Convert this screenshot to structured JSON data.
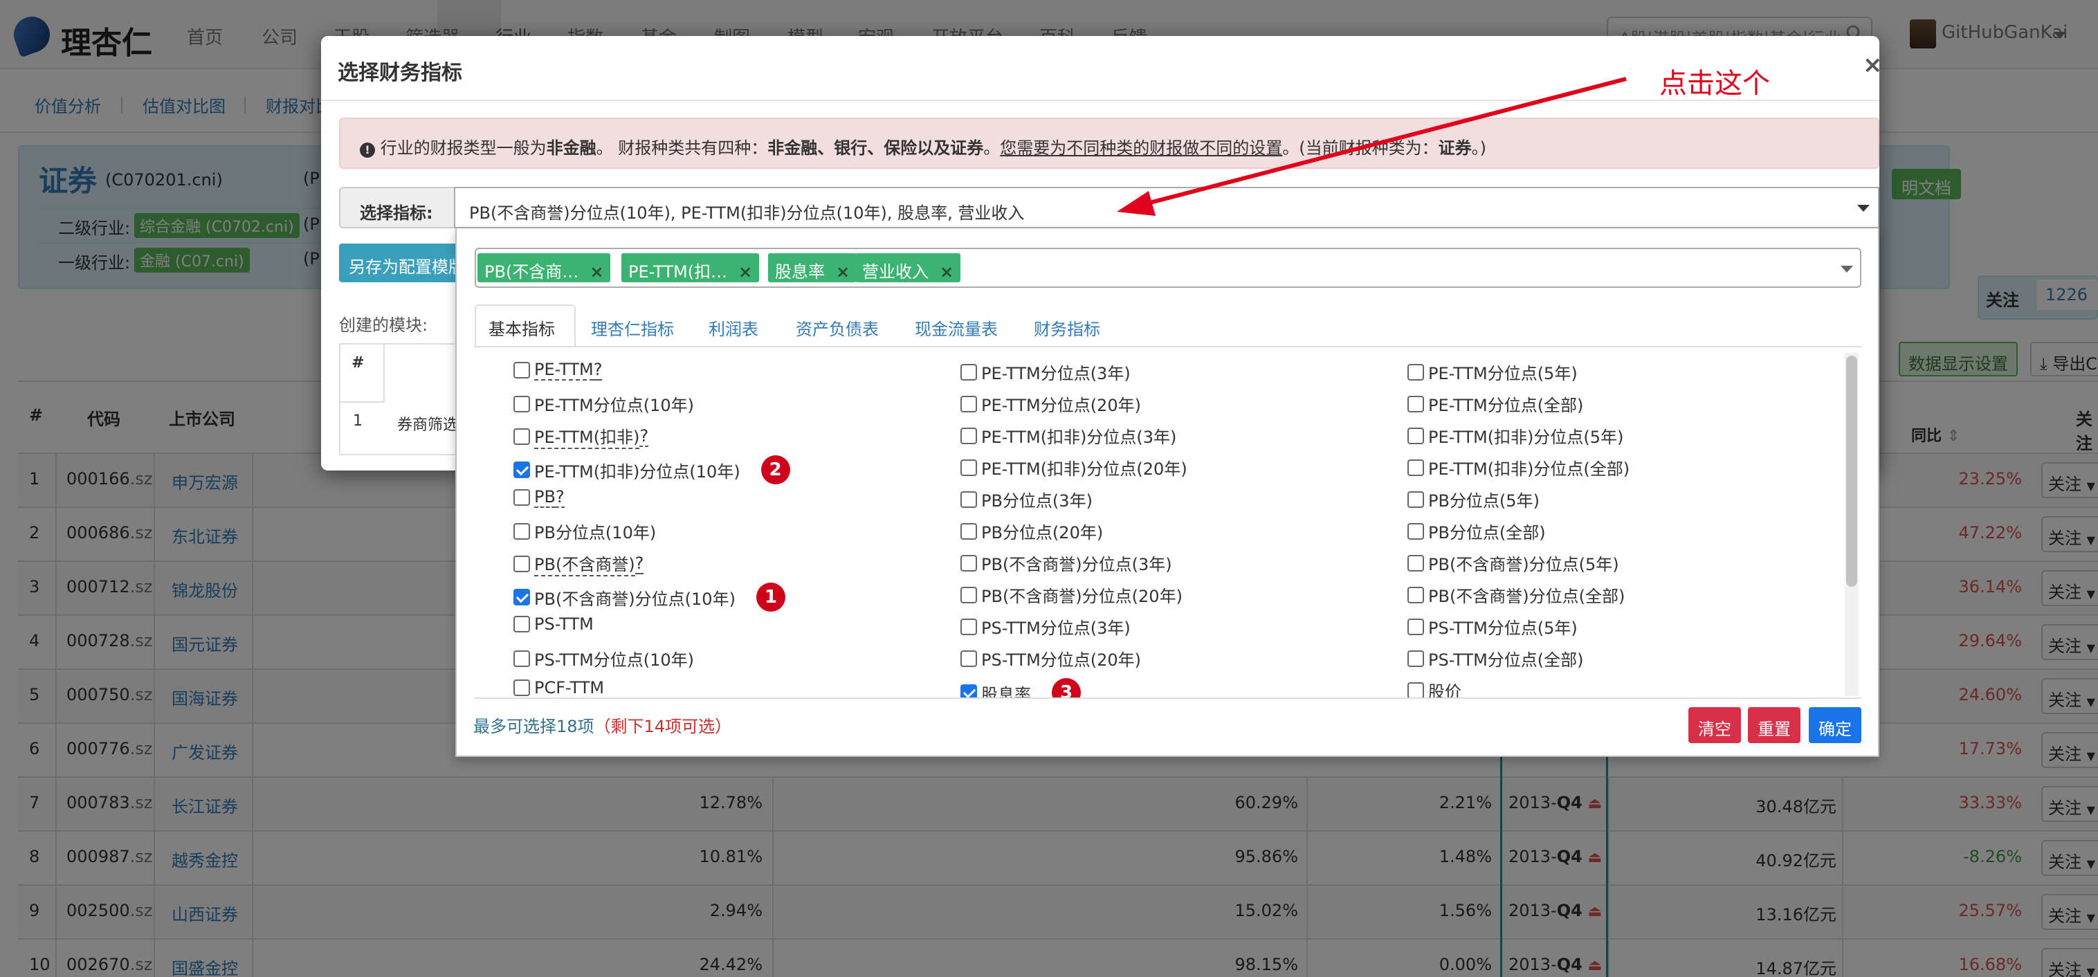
{
  "brand": {
    "name": "理杏仁"
  },
  "topnav": {
    "items": [
      "首页",
      "公司",
      "干股",
      "筛选器",
      "行业",
      "指数",
      "基金",
      "制图",
      "模型",
      "宏观",
      "开放平台",
      "百科",
      "反馈"
    ],
    "search_placeholder": "A股|港股|美股|指数|基金|行业",
    "user": "GitHubGanKai"
  },
  "subnav": {
    "items": [
      "价值分析",
      "估值对比图",
      "财报对比"
    ]
  },
  "industry": {
    "title": "证券",
    "code": "(C070201.cni)",
    "level2_label": "二级行业:",
    "level2_value": "综合金融 (C0702.cni)",
    "level1_label": "一级行业:",
    "level1_value": "金融 (C07.cni)",
    "pe_prefix": "(P",
    "doc_btn": "明文档"
  },
  "follow": {
    "label": "关注",
    "count": "1226"
  },
  "toolbar": {
    "display_setting": "数据显示设置",
    "export": "导出C"
  },
  "table": {
    "headers": {
      "idx": "#",
      "code": "代码",
      "company": "上市公司",
      "yoy": "同比",
      "follow": "关注"
    },
    "rows": [
      {
        "idx": "1",
        "code": "000166",
        "suffix": ".sz",
        "name": "申万宏源",
        "yoy": "23.25%",
        "yoy_color": "red"
      },
      {
        "idx": "2",
        "code": "000686",
        "suffix": ".sz",
        "name": "东北证券",
        "yoy": "47.22%",
        "yoy_color": "red"
      },
      {
        "idx": "3",
        "code": "000712",
        "suffix": ".sz",
        "name": "锦龙股份",
        "yoy": "36.14%",
        "yoy_color": "red"
      },
      {
        "idx": "4",
        "code": "000728",
        "suffix": ".sz",
        "name": "国元证券",
        "yoy": "29.64%",
        "yoy_color": "red"
      },
      {
        "idx": "5",
        "code": "000750",
        "suffix": ".sz",
        "name": "国海证券",
        "yoy": "24.60%",
        "yoy_color": "red"
      },
      {
        "idx": "6",
        "code": "000776",
        "suffix": ".sz",
        "name": "广发证券",
        "yoy": "17.73%",
        "yoy_color": "red"
      },
      {
        "idx": "7",
        "code": "000783",
        "suffix": ".sz",
        "name": "长江证券",
        "c1": "12.78%",
        "c2": "60.29%",
        "c3": "2.21%",
        "period": "2013-",
        "q": "Q4",
        "rev": "30.48亿元",
        "yoy": "33.33%",
        "yoy_color": "red"
      },
      {
        "idx": "8",
        "code": "000987",
        "suffix": ".sz",
        "name": "越秀金控",
        "c1": "10.81%",
        "c2": "95.86%",
        "c3": "1.48%",
        "period": "2013-",
        "q": "Q4",
        "rev": "40.92亿元",
        "yoy": "-8.26%",
        "yoy_color": "green"
      },
      {
        "idx": "9",
        "code": "002500",
        "suffix": ".sz",
        "name": "山西证券",
        "c1": "2.94%",
        "c2": "15.02%",
        "c3": "1.56%",
        "period": "2013-",
        "q": "Q4",
        "rev": "13.16亿元",
        "yoy": "25.57%",
        "yoy_color": "red"
      },
      {
        "idx": "10",
        "code": "002670",
        "suffix": ".sz",
        "name": "国盛金控",
        "c1": "24.42%",
        "c2": "98.15%",
        "c3": "0.00%",
        "period": "2013-",
        "q": "Q4",
        "rev": "14.87亿元",
        "yoy": "16.68%",
        "yoy_color": "red"
      }
    ],
    "follow_btn": "关注"
  },
  "modal": {
    "title": "选择财务指标",
    "close": "×",
    "alert": {
      "p1": "行业的财报类型一般为",
      "b1": "非金融",
      "p2": "。 财报种类共有四种：",
      "b2": "非金融、银行、保险以及证券",
      "p3": "。",
      "link": "您需要为不同种类的财报做不同的设置",
      "p4": "。(当前财报种类为：",
      "b3": "证券",
      "p5": "。)"
    },
    "select_label": "选择指标:",
    "select_value": "PB(不含商誉)分位点(10年), PE-TTM(扣非)分位点(10年), 股息率, 营业收入",
    "save_config": "另存为配置模版",
    "created_label": "创建的模块:",
    "module_hash": "#",
    "module_row_idx": "1",
    "module_row_name": "券商筛选"
  },
  "dropdown": {
    "tags": [
      "PB(不含商…",
      "PE-TTM(扣…",
      "股息率",
      "营业收入"
    ],
    "tabs": [
      "基本指标",
      "理杏仁指标",
      "利润表",
      "资产负债表",
      "现金流量表",
      "财务指标"
    ],
    "options": [
      [
        {
          "label": "PE-TTM",
          "q": true,
          "checked": false
        },
        {
          "label": "PE-TTM分位点(3年)",
          "checked": false
        },
        {
          "label": "PE-TTM分位点(5年)",
          "checked": false
        }
      ],
      [
        {
          "label": "PE-TTM分位点(10年)",
          "checked": false
        },
        {
          "label": "PE-TTM分位点(20年)",
          "checked": false
        },
        {
          "label": "PE-TTM分位点(全部)",
          "checked": false
        }
      ],
      [
        {
          "label": "PE-TTM(扣非)",
          "q": true,
          "checked": false
        },
        {
          "label": "PE-TTM(扣非)分位点(3年)",
          "checked": false
        },
        {
          "label": "PE-TTM(扣非)分位点(5年)",
          "checked": false
        }
      ],
      [
        {
          "label": "PE-TTM(扣非)分位点(10年)",
          "checked": true,
          "badge": "2"
        },
        {
          "label": "PE-TTM(扣非)分位点(20年)",
          "checked": false
        },
        {
          "label": "PE-TTM(扣非)分位点(全部)",
          "checked": false
        }
      ],
      [
        {
          "label": "PB",
          "q": true,
          "checked": false
        },
        {
          "label": "PB分位点(3年)",
          "checked": false
        },
        {
          "label": "PB分位点(5年)",
          "checked": false
        }
      ],
      [
        {
          "label": "PB分位点(10年)",
          "checked": false
        },
        {
          "label": "PB分位点(20年)",
          "checked": false
        },
        {
          "label": "PB分位点(全部)",
          "checked": false
        }
      ],
      [
        {
          "label": "PB(不含商誉)",
          "q": true,
          "checked": false
        },
        {
          "label": "PB(不含商誉)分位点(3年)",
          "checked": false
        },
        {
          "label": "PB(不含商誉)分位点(5年)",
          "checked": false
        }
      ],
      [
        {
          "label": "PB(不含商誉)分位点(10年)",
          "checked": true,
          "badge": "1"
        },
        {
          "label": "PB(不含商誉)分位点(20年)",
          "checked": false
        },
        {
          "label": "PB(不含商誉)分位点(全部)",
          "checked": false
        }
      ],
      [
        {
          "label": "PS-TTM",
          "checked": false
        },
        {
          "label": "PS-TTM分位点(3年)",
          "checked": false
        },
        {
          "label": "PS-TTM分位点(5年)",
          "checked": false
        }
      ],
      [
        {
          "label": "PS-TTM分位点(10年)",
          "checked": false
        },
        {
          "label": "PS-TTM分位点(20年)",
          "checked": false
        },
        {
          "label": "PS-TTM分位点(全部)",
          "checked": false
        }
      ],
      [
        {
          "label": "PCF-TTM",
          "checked": false
        },
        {
          "label": "股息率",
          "checked": true,
          "badge": "3"
        },
        {
          "label": "股价",
          "checked": false
        }
      ]
    ],
    "limit_text": "最多可选择18项",
    "limit_remaining": "（剩下14项可选）",
    "clear": "清空",
    "reset": "重置",
    "ok": "确定"
  },
  "annotation": {
    "text": "点击这个",
    "color": "#e0001b"
  }
}
